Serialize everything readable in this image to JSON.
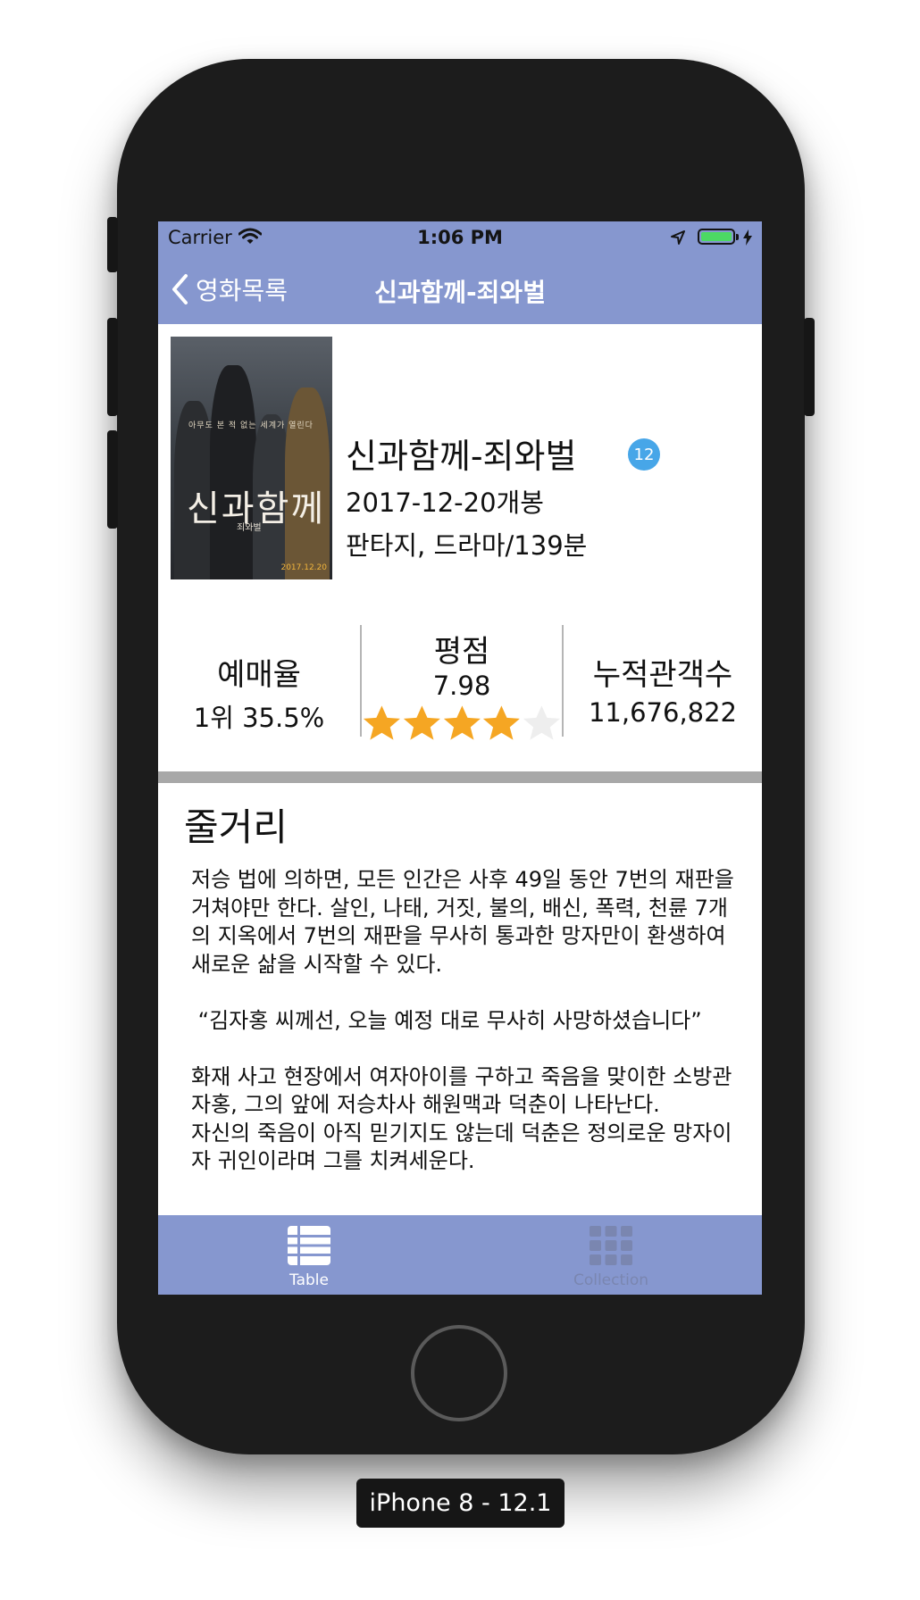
{
  "status_bar": {
    "carrier": "Carrier",
    "time": "1:06 PM"
  },
  "nav": {
    "back_label": "영화목록",
    "title": "신과함께-죄와벌"
  },
  "movie": {
    "poster_tagline": "아무도 본 적 없는 세계가 열린다",
    "poster_title": "신과함께",
    "poster_subtitle": "죄와벌",
    "poster_date": "2017.12.20",
    "title": "신과함께-죄와벌",
    "grade": "12",
    "release": "2017-12-20개봉",
    "genre": "판타지, 드라마/139분"
  },
  "stats": {
    "reservation_label": "예매율",
    "reservation_value": "1위 35.5%",
    "rating_label": "평점",
    "rating_value": "7.98",
    "rating_stars_fraction": 0.798,
    "audience_label": "누적관객수",
    "audience_value": "11,676,822"
  },
  "synopsis": {
    "heading": "줄거리",
    "body": "저승 법에 의하면, 모든 인간은 사후 49일 동안 7번의 재판을 거쳐야만 한다. 살인, 나태, 거짓, 불의, 배신, 폭력, 천륜 7개의 지옥에서 7번의 재판을 무사히 통과한 망자만이 환생하여 새로운 삶을 시작할 수 있다.\n\n “김자홍 씨께선, 오늘 예정 대로 무사히 사망하셨습니다”\n\n화재 사고 현장에서 여자아이를 구하고 죽음을 맞이한 소방관 자홍, 그의 앞에 저승차사 해원맥과 덕춘이 나타난다.\n자신의 죽음이 아직 믿기지도 않는데 덕춘은 정의로운 망자이자 귀인이라며 그를 치켜세운다."
  },
  "tabs": [
    {
      "label": "Table",
      "icon": "list-icon",
      "selected": true
    },
    {
      "label": "Collection",
      "icon": "grid-icon",
      "selected": false
    }
  ],
  "device_label": "iPhone 8 - 12.1",
  "colors": {
    "nav_bg": "#8697cf",
    "star_on": "#f5a623",
    "star_off": "#eeeeee",
    "grade_badge": "#47a6e8",
    "separator": "#a8a8a8"
  }
}
